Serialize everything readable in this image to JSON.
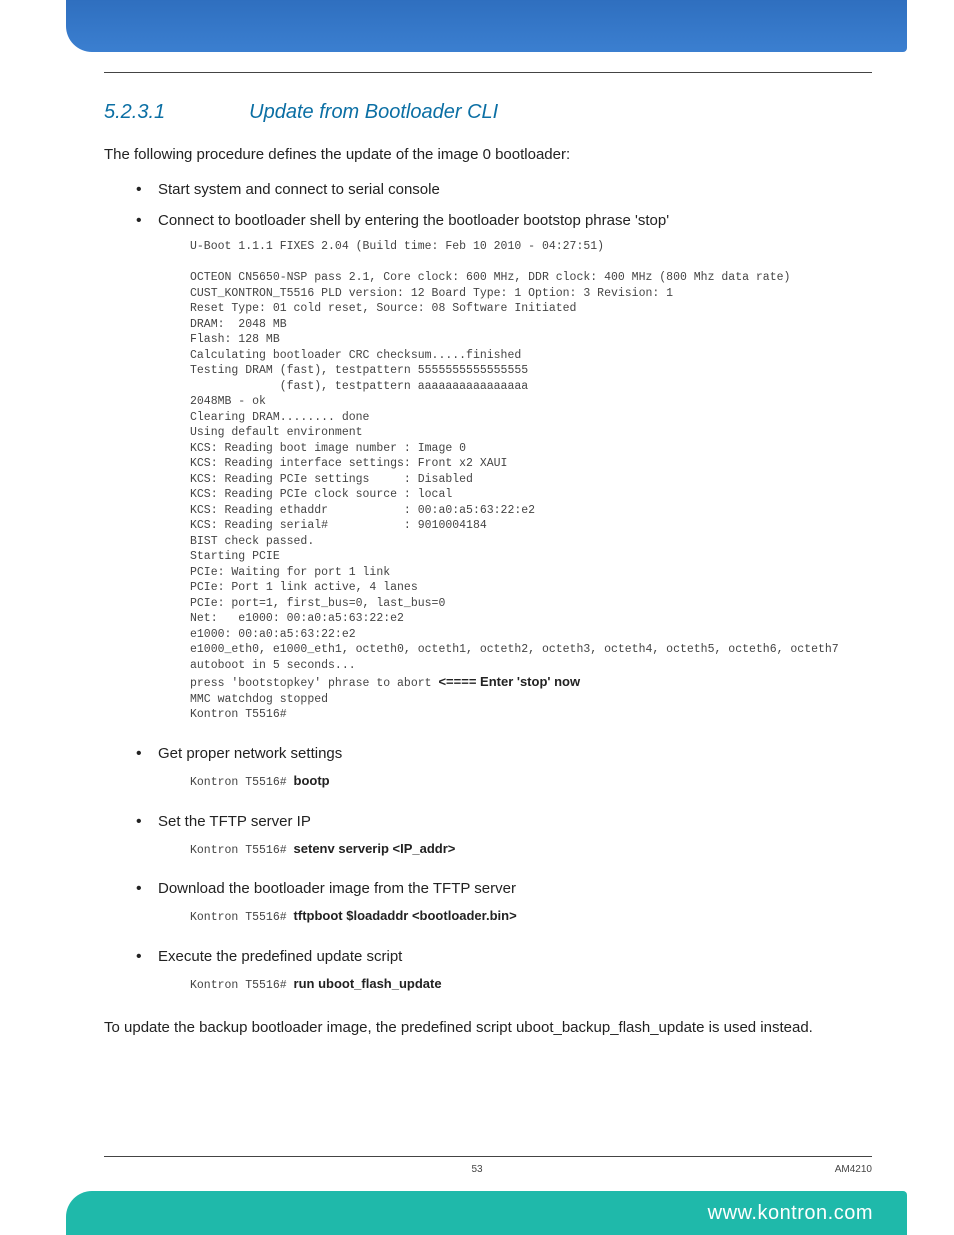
{
  "section": {
    "number": "5.2.3.1",
    "title": "Update from Bootloader CLI"
  },
  "intro": "The following procedure defines the update of the image 0 bootloader:",
  "steps": [
    {
      "text": "Start system and connect to serial console",
      "code": null
    },
    {
      "text": "Connect to bootloader shell by entering the bootloader bootstop phrase 'stop'",
      "code_pre1": "U-Boot 1.1.1 FIXES 2.04 (Build time: Feb 10 2010 - 04:27:51)\n\nOCTEON CN5650-NSP pass 2.1, Core clock: 600 MHz, DDR clock: 400 MHz (800 Mhz data rate)\nCUST_KONTRON_T5516 PLD version: 12 Board Type: 1 Option: 3 Revision: 1\nReset Type: 01 cold reset, Source: 08 Software Initiated\nDRAM:  2048 MB\nFlash: 128 MB\nCalculating bootloader CRC checksum.....finished\nTesting DRAM (fast), testpattern 5555555555555555\n             (fast), testpattern aaaaaaaaaaaaaaaa\n2048MB - ok\nClearing DRAM........ done\nUsing default environment\nKCS: Reading boot image number : Image 0\nKCS: Reading interface settings: Front x2 XAUI\nKCS: Reading PCIe settings     : Disabled\nKCS: Reading PCIe clock source : local\nKCS: Reading ethaddr           : 00:a0:a5:63:22:e2\nKCS: Reading serial#           : 9010004184\nBIST check passed.\nStarting PCIE\nPCIe: Waiting for port 1 link\nPCIe: Port 1 link active, 4 lanes\nPCIe: port=1, first_bus=0, last_bus=0\nNet:   e1000: 00:a0:a5:63:22:e2\ne1000: 00:a0:a5:63:22:e2\ne1000_eth0, e1000_eth1, octeth0, octeth1, octeth2, octeth3, octeth4, octeth5, octeth6, octeth7\nautoboot in 5 seconds...\npress 'bootstopkey' phrase to abort ",
      "code_bold": "<==== Enter 'stop' now",
      "code_pre2": "\nMMC watchdog stopped\nKontron T5516#"
    },
    {
      "text": "Get proper network settings",
      "code_prompt": "Kontron T5516# ",
      "code_cmd": "bootp"
    },
    {
      "text": "Set the TFTP server IP",
      "code_prompt": "Kontron T5516# ",
      "code_cmd": "setenv serverip <IP_addr>"
    },
    {
      "text": "Download the bootloader image from the TFTP server",
      "code_prompt": "Kontron T5516# ",
      "code_cmd": "tftpboot $loadaddr <bootloader.bin>"
    },
    {
      "text": "Execute the predefined update script",
      "code_prompt": "Kontron T5516# ",
      "code_cmd": "run uboot_flash_update"
    }
  ],
  "closing": "To update the backup bootloader image, the predefined script uboot_backup_flash_update is used instead.",
  "footer": {
    "page": "53",
    "doc_id": "AM4210",
    "url": "www.kontron.com"
  }
}
